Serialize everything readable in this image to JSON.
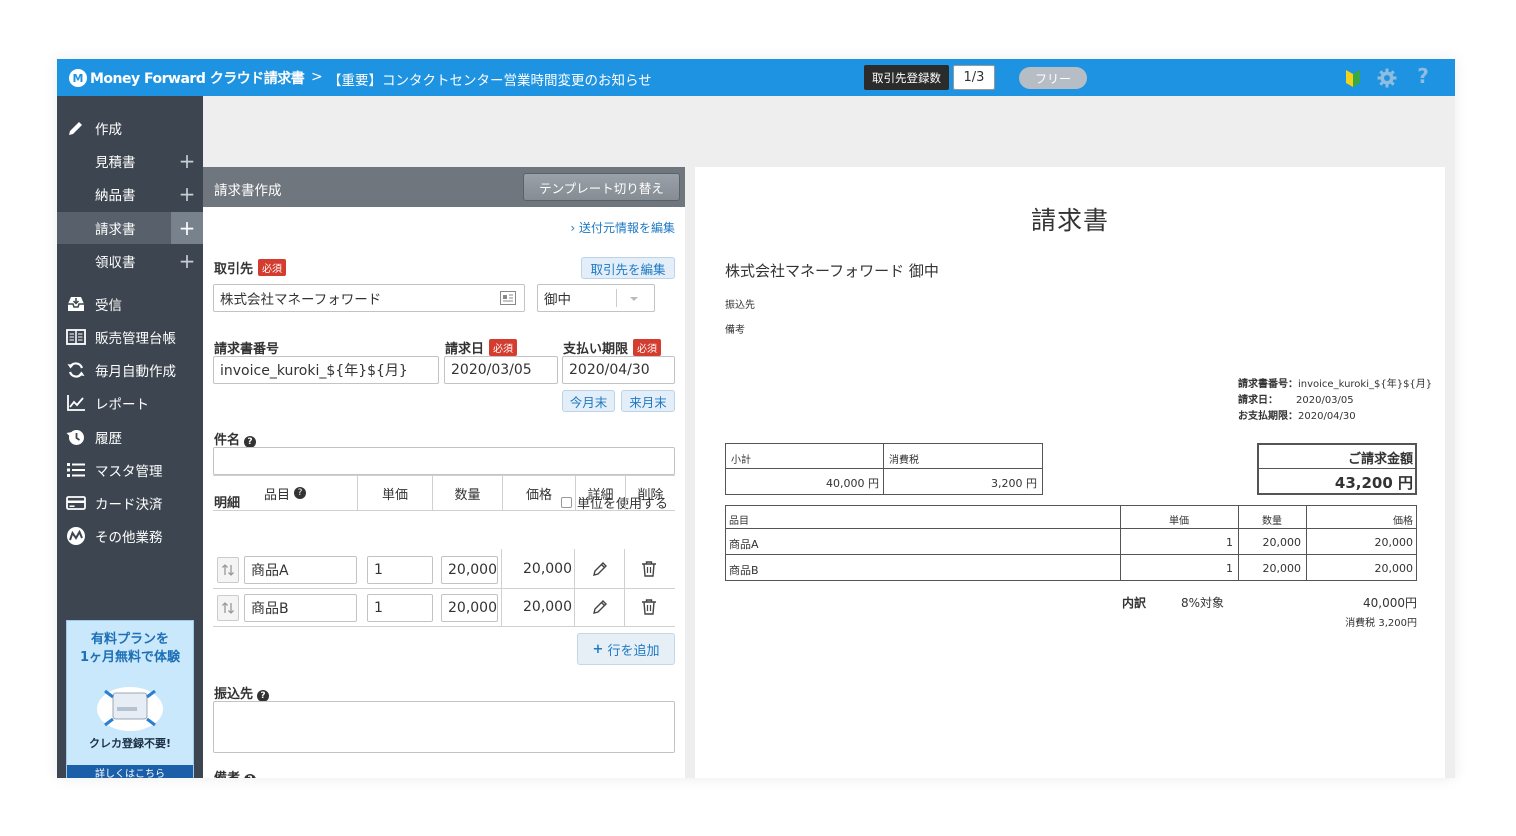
{
  "header": {
    "logo_text": "Money Forward クラウド請求書",
    "notice_chevron": ">",
    "notice": "【重要】コンタクトセンター営業時間変更のお知らせ",
    "registered_label": "取引先登録数",
    "registered_count": "1/3",
    "plan": "フリー"
  },
  "sidebar": {
    "create": "作成",
    "items": [
      {
        "label": "見積書"
      },
      {
        "label": "納品書"
      },
      {
        "label": "請求書"
      },
      {
        "label": "領収書"
      }
    ],
    "nav": [
      {
        "label": "受信",
        "icon": "inbox-icon"
      },
      {
        "label": "販売管理台帳",
        "icon": "ledger-icon"
      },
      {
        "label": "毎月自動作成",
        "icon": "refresh-icon"
      },
      {
        "label": "レポート",
        "icon": "chart-icon"
      },
      {
        "label": "履歴",
        "icon": "history-icon"
      },
      {
        "label": "マスタ管理",
        "icon": "list-icon"
      },
      {
        "label": "カード決済",
        "icon": "card-icon"
      },
      {
        "label": "その他業務",
        "icon": "logo-icon"
      }
    ],
    "promo": {
      "line1": "有料プランを",
      "line2": "1ヶ月無料で体験",
      "sub": "クレカ登録不要!",
      "button": "詳しくはこちら"
    }
  },
  "form": {
    "title": "請求書作成",
    "template_button": "テンプレート切り替え",
    "sender_link": "› 送付元情報を編集",
    "required": "必須",
    "client_label": "取引先",
    "client_edit": "取引先を編集",
    "client_value": "株式会社マネーフォワード",
    "honorific": "御中",
    "invoice_no_label": "請求書番号",
    "invoice_no": "invoice_kuroki_${年}${月}",
    "invoice_date_label": "請求日",
    "invoice_date": "2020/03/05",
    "due_label": "支払い期限",
    "due_date": "2020/04/30",
    "this_month_end": "今月末",
    "next_month_end": "来月末",
    "subject_label": "件名",
    "subject_value": "",
    "details_label": "明細",
    "use_unit": "単位を使用する",
    "columns": [
      "品目",
      "単価",
      "数量",
      "価格",
      "詳細",
      "削除"
    ],
    "rows": [
      {
        "item": "商品A",
        "unit_price": "1",
        "qty": "20,000",
        "price": "20,000"
      },
      {
        "item": "商品B",
        "unit_price": "1",
        "qty": "20,000",
        "price": "20,000"
      }
    ],
    "add_row": "行を追加",
    "bank_label": "振込先",
    "bank_value": "",
    "notes_label": "備考"
  },
  "preview": {
    "title": "請求書",
    "client": "株式会社マネーフォワード 御中",
    "bank_label": "振込先",
    "notes_label": "備考",
    "meta": {
      "no_label": "請求書番号：",
      "no": "invoice_kuroki_${年}${月}",
      "date_label": "請求日：",
      "date": "2020/03/05",
      "due_label": "お支払期限：",
      "due": "2020/04/30"
    },
    "subtotal_label": "小計",
    "subtotal": "40,000 円",
    "tax_label": "消費税",
    "tax": "3,200 円",
    "total_label": "ご請求金額",
    "total": "43,200 円",
    "table_headers": [
      "品目",
      "単価",
      "数量",
      "価格"
    ],
    "table_rows": [
      {
        "item": "商品A",
        "unit_price": "1",
        "qty": "20,000",
        "price": "20,000"
      },
      {
        "item": "商品B",
        "unit_price": "1",
        "qty": "20,000",
        "price": "20,000"
      }
    ],
    "breakdown_label": "内訳",
    "breakdown_rate": "8%対象",
    "breakdown_amount": "40,000円",
    "breakdown_tax": "消費税 3,200円"
  }
}
